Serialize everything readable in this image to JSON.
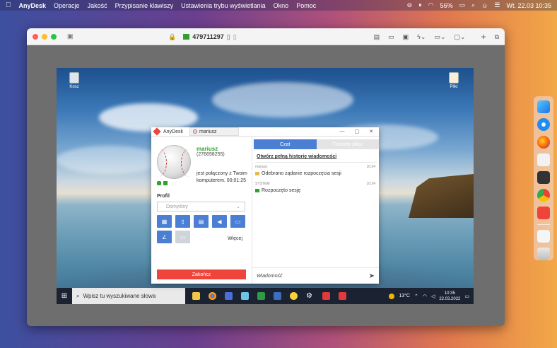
{
  "menubar": {
    "apple": "",
    "app": "AnyDesk",
    "items": [
      "Operacje",
      "Jakość",
      "Przypisanie klawiszy",
      "Ustawienia trybu wyświetlania",
      "Okno",
      "Pomoc"
    ],
    "battery": "56%",
    "datetime": "Wt. 22.03  10:35"
  },
  "window": {
    "connection_id": "479711297"
  },
  "desktop": {
    "icon1": "Kosz",
    "icon2": "Pliki"
  },
  "taskbar": {
    "start": "⊞",
    "search_placeholder": "Wpisz tu wyszukiwane słowa",
    "weather": "13°C",
    "time": "10:35",
    "date": "22.03.2022"
  },
  "anydesk": {
    "app_title": "AnyDesk",
    "tab_label": "mariusz",
    "user_name": "mariusz",
    "user_id": "(276698255)",
    "status": "jest połączony z Twoim komputerem. 00:01:25",
    "profile_label": "Profil",
    "profile_value": "Domyślny",
    "more_label": "Więcej",
    "end_label": "Zakończ",
    "tab_chat": "Czat",
    "tab_transfer": "Transfer pliku",
    "history_link": "Otwórz pełną historię wiadomości",
    "messages": [
      {
        "who": "mariusz",
        "time": "10:34",
        "text": "Odebrano żądanie rozpoczęcia sesji"
      },
      {
        "who": "SYSTEM",
        "time": "10:34",
        "text": "Rozpoczęto sesję"
      }
    ],
    "chat_placeholder": "Wiadomość"
  },
  "colors": {
    "accent": "#4a7fd4",
    "end": "#ef443b",
    "online": "#2ea12e"
  }
}
